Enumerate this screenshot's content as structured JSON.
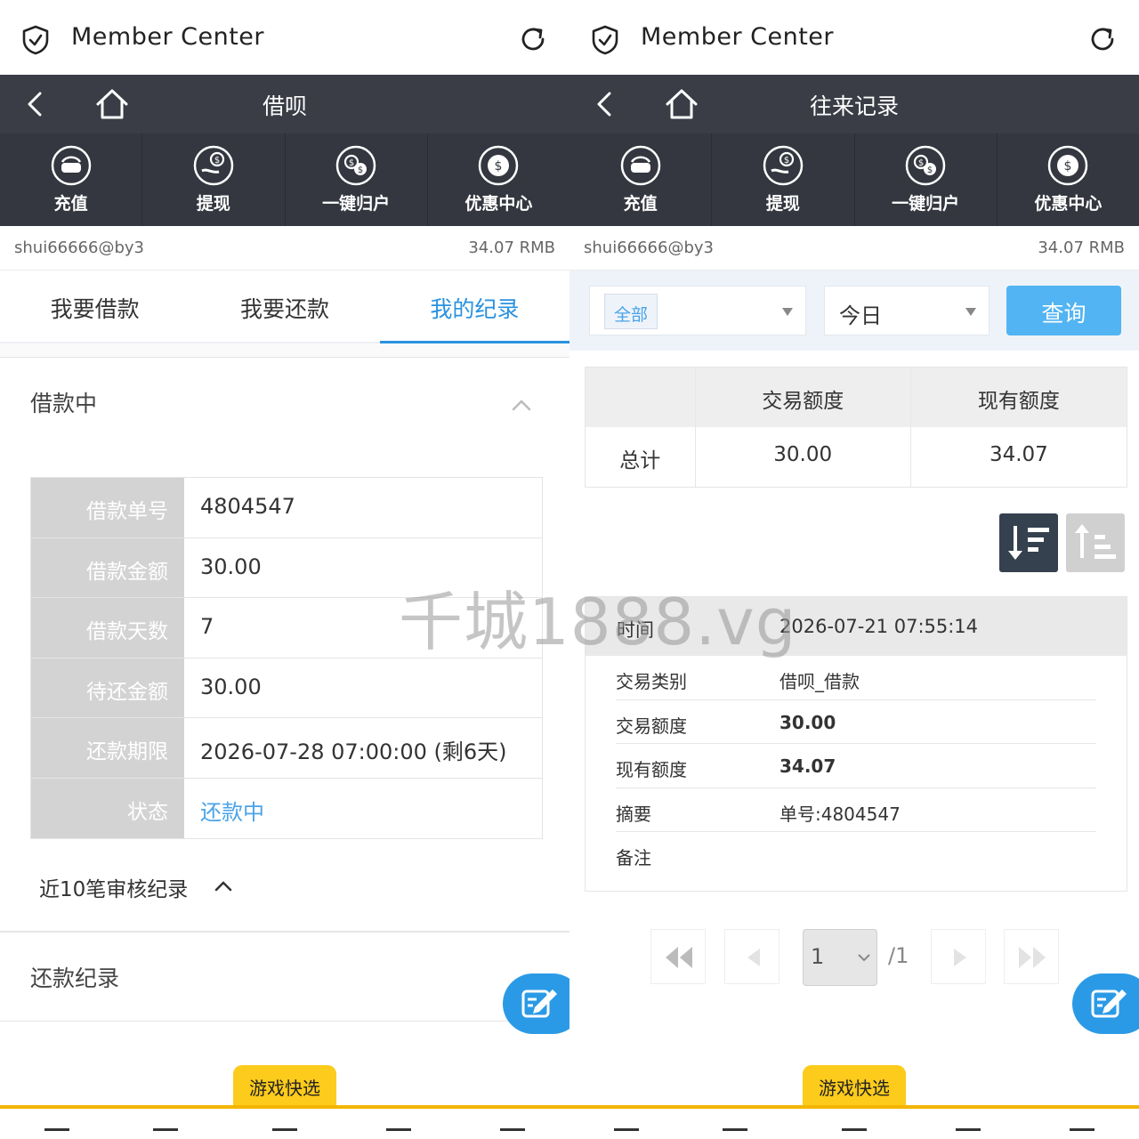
{
  "left": {
    "browser_title": "Member Center",
    "header_title": "借呗",
    "functions": [
      "充值",
      "提现",
      "一键归户",
      "优惠中心"
    ],
    "username": "shui66666@by3",
    "balance": "34.07 RMB",
    "tabs": [
      "我要借款",
      "我要还款",
      "我的纪录"
    ],
    "section_borrowing": "借款中",
    "detail": [
      {
        "label": "借款单号",
        "value": "4804547"
      },
      {
        "label": "借款金额",
        "value": "30.00"
      },
      {
        "label": "借款天数",
        "value": "7"
      },
      {
        "label": "待还金额",
        "value": "30.00"
      },
      {
        "label": "还款期限",
        "value": "2026-07-28 07:00:00 (剩6天)"
      },
      {
        "label": "状态",
        "value": "还款中"
      }
    ],
    "audit_label": "近10笔审核纪录",
    "section_repay": "还款纪录",
    "quick_pick": "游戏快选"
  },
  "right": {
    "browser_title": "Member Center",
    "header_title": "往来记录",
    "functions": [
      "充值",
      "提现",
      "一键归户",
      "优惠中心"
    ],
    "username": "shui66666@by3",
    "balance": "34.07 RMB",
    "filter_type": "全部",
    "filter_date": "今日",
    "query_button": "查询",
    "summary": {
      "headers": [
        "",
        "交易额度",
        "现有额度"
      ],
      "row": [
        "总计",
        "30.00",
        "34.07"
      ]
    },
    "record": {
      "time_label": "时间",
      "time_value": "2026-07-21 07:55:14",
      "rows": [
        {
          "label": "交易类别",
          "value": "借呗_借款"
        },
        {
          "label": "交易额度",
          "value": "30.00"
        },
        {
          "label": "现有额度",
          "value": "34.07"
        },
        {
          "label": "摘要",
          "value": "单号:4804547"
        },
        {
          "label": "备注",
          "value": ""
        }
      ]
    },
    "pager": {
      "page": "1",
      "total": "/1"
    },
    "quick_pick": "游戏快选"
  },
  "watermark": "千城1888.vg",
  "colors": {
    "accent": "#2a92df",
    "query": "#52b4f2",
    "header": "#3a3d46",
    "quick": "#fccb1b"
  }
}
